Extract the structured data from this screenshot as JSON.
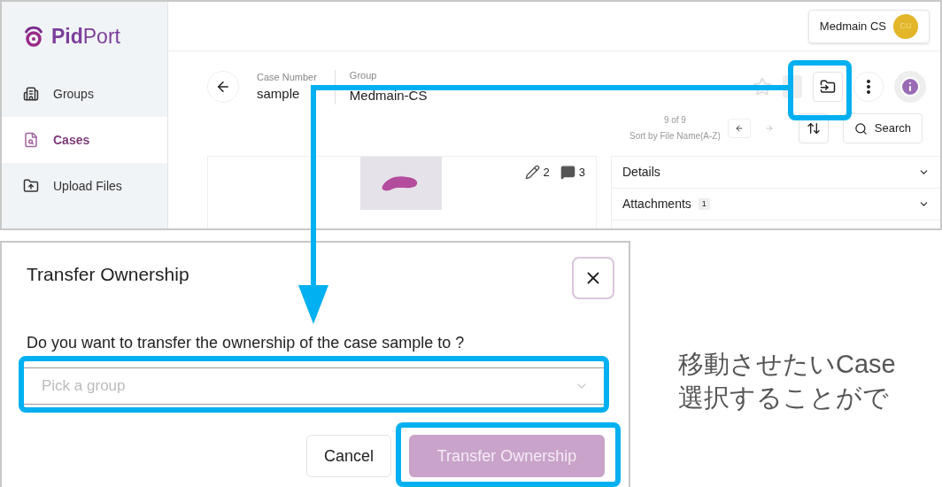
{
  "app": {
    "logo": "**Pid**Port",
    "sidebar": {
      "items": [
        {
          "label": "Groups",
          "selected": false
        },
        {
          "label": "Cases",
          "selected": true
        },
        {
          "label": "Upload Files",
          "selected": false
        }
      ]
    },
    "user": {
      "name": "Medmain CS",
      "initials": "CU"
    },
    "case": {
      "case_number_label": "Case Number",
      "case_number": "sample",
      "group_label": "Group",
      "group": "Medmain-CS"
    },
    "pager": {
      "position": "9 of 9",
      "sort": "Sort by File Name(A-Z)"
    },
    "search_button": "Search",
    "file_card": {
      "annotations": "2",
      "comments": "3"
    },
    "panels": [
      {
        "label": "Details"
      },
      {
        "label": "Attachments",
        "count": "1"
      }
    ]
  },
  "dialog": {
    "title": "Transfer Ownership",
    "question": "Do you want to transfer the ownership of the case sample to ?",
    "select": {
      "placeholder": "Pick a group"
    },
    "buttons": [
      {
        "label": "Cancel",
        "kind": "secondary",
        "disabled": false
      },
      {
        "label": "Transfer Ownership",
        "kind": "primary",
        "disabled": true
      }
    ]
  },
  "note": {
    "lines": [
      "移動させたいCase",
      "選択することがで"
    ]
  }
}
